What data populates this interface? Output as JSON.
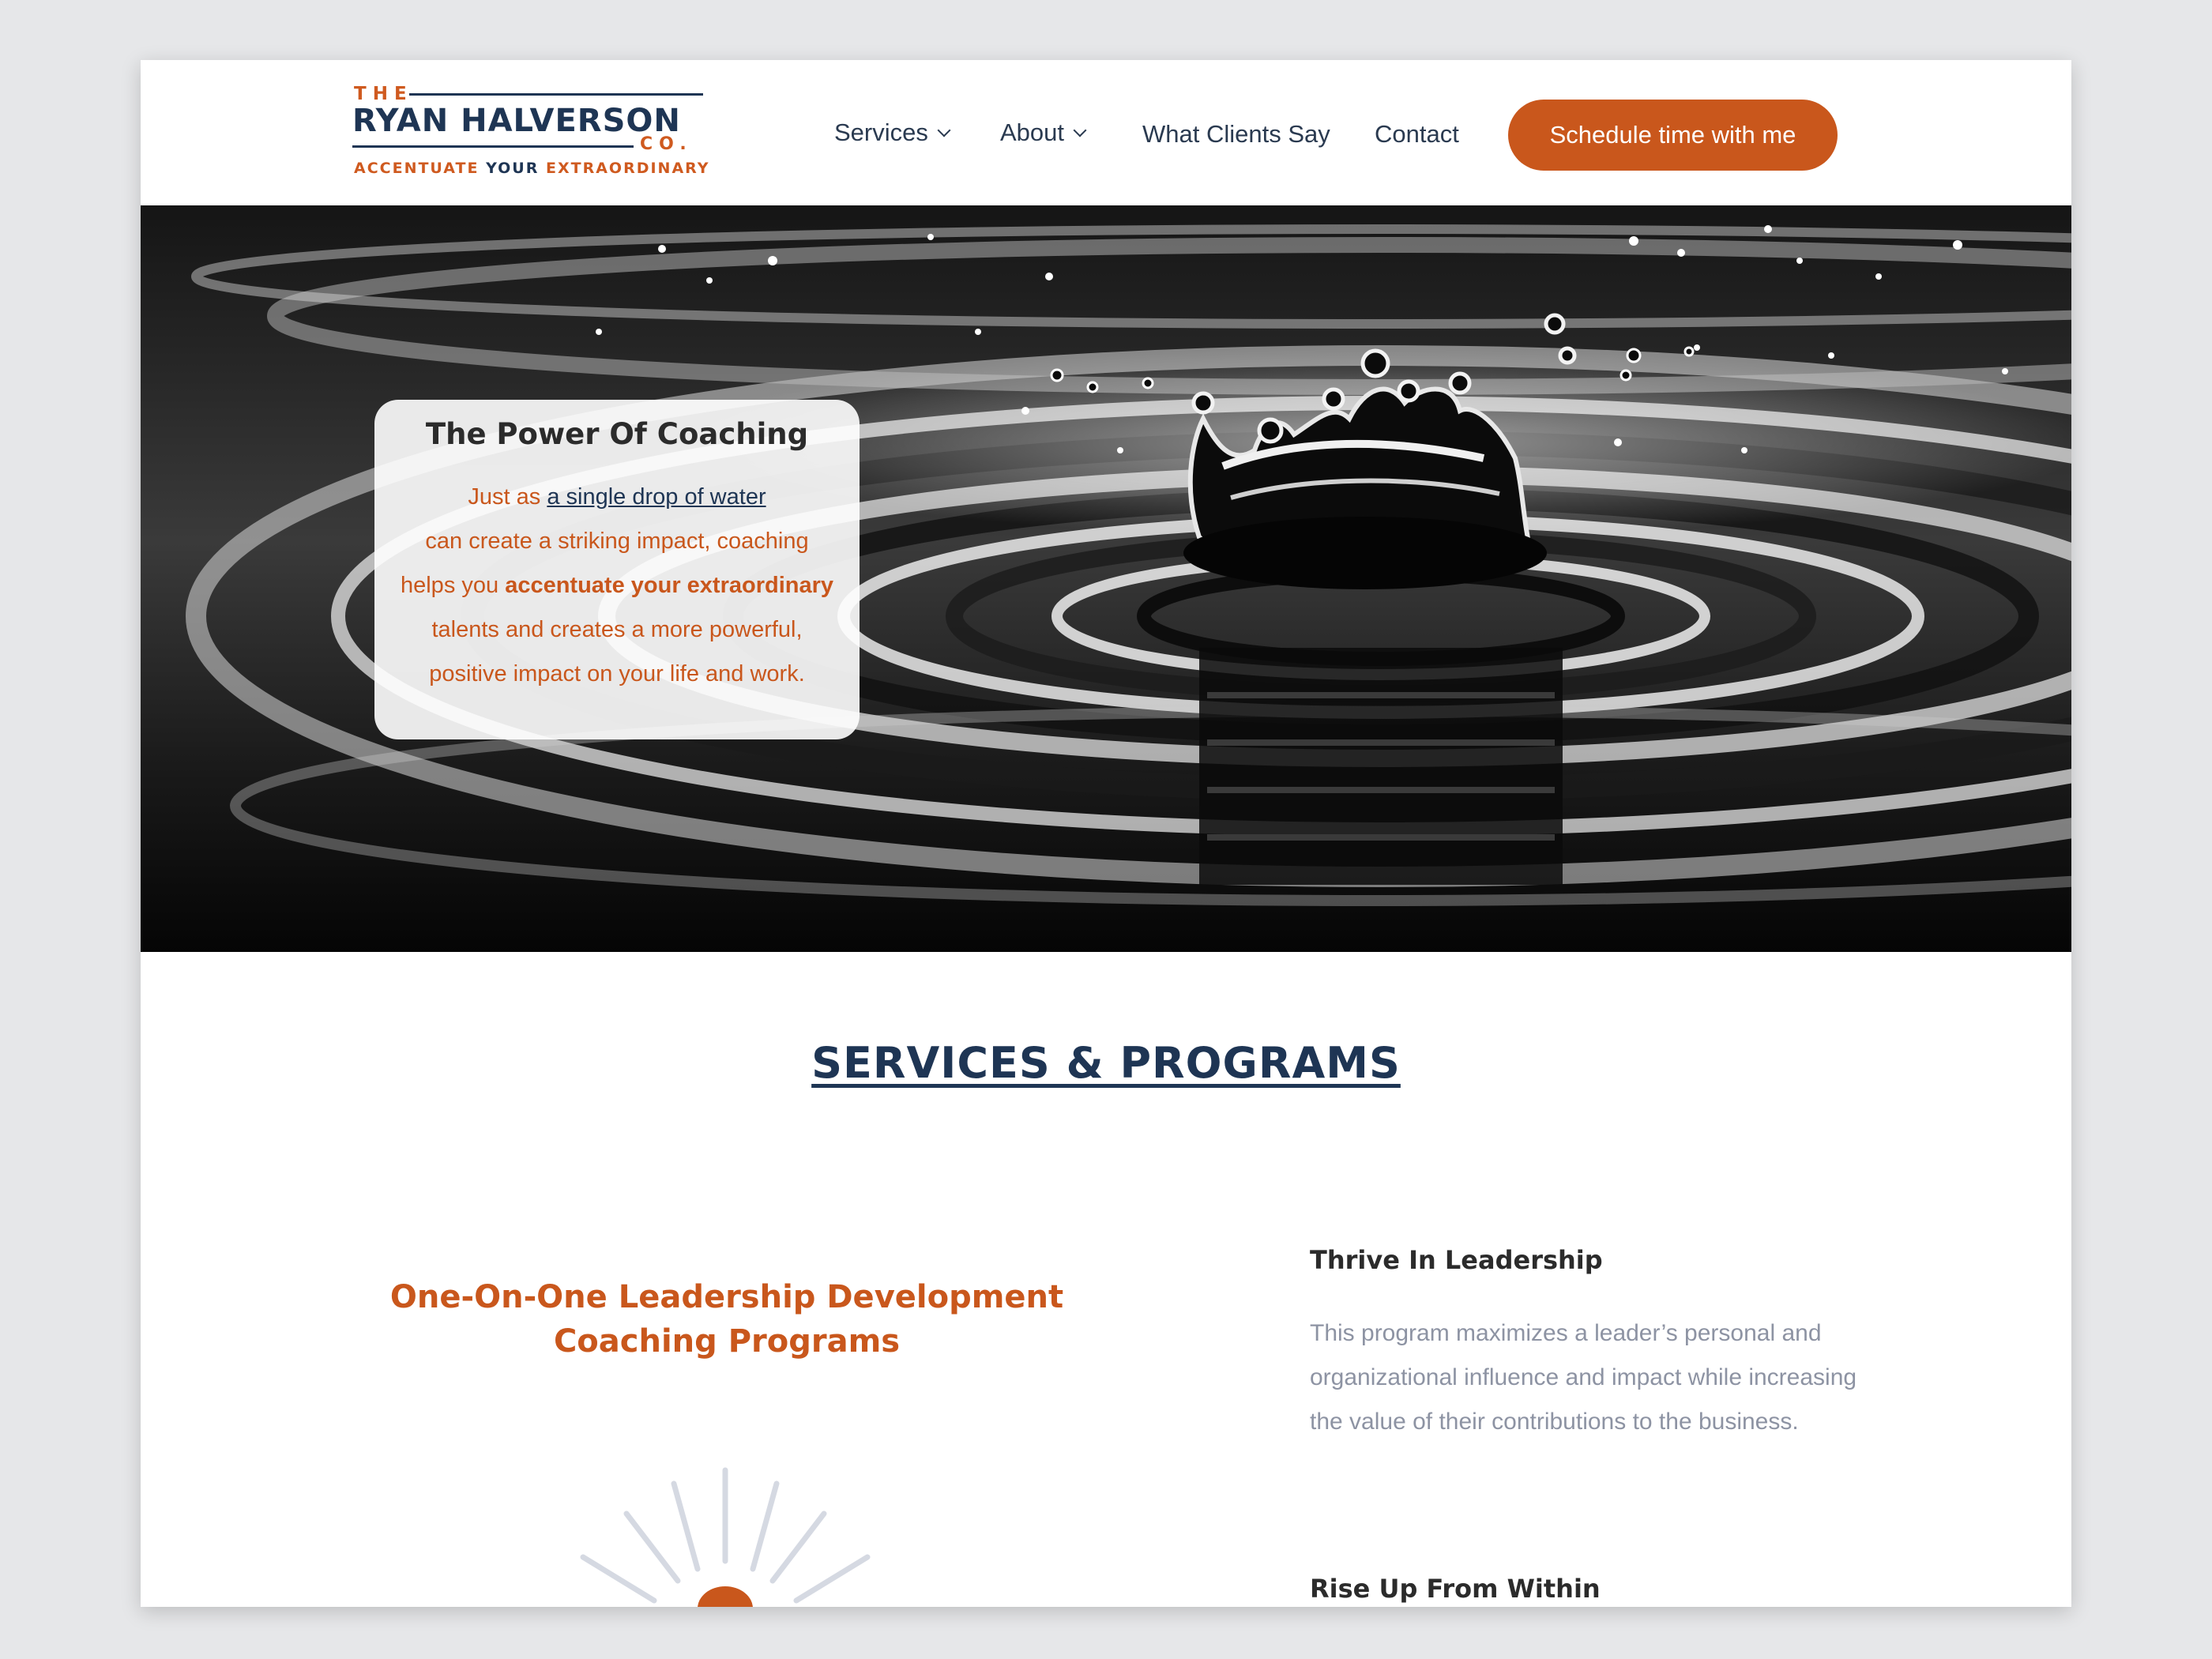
{
  "brand": {
    "the": "THE",
    "name": "RYAN HALVERSON",
    "co": "CO.",
    "tagline_a": "ACCENTUATE",
    "tagline_b": "YOUR",
    "tagline_c": "EXTRAORDINARY"
  },
  "nav": {
    "items": [
      {
        "label": "Services",
        "dropdown": true
      },
      {
        "label": "About",
        "dropdown": true
      },
      {
        "label": "What Clients Say",
        "dropdown": false
      },
      {
        "label": "Contact",
        "dropdown": false
      }
    ],
    "cta": "Schedule time with me"
  },
  "hero": {
    "title": "The Power Of Coaching",
    "line1_pre": "Just as ",
    "line1_link": "a single drop of water",
    "line2": "can create a striking impact, coaching",
    "line3_pre": "helps you ",
    "line3_bold": "accentuate your extraordinary",
    "line4": "talents and creates a more powerful,",
    "line5": "positive impact on your life and work."
  },
  "services": {
    "section_title": "SERVICES & PROGRAMS",
    "program_heading_1": "One-On-One Leadership Development",
    "program_heading_2": "Coaching Programs",
    "items": [
      {
        "title": "Thrive In Leadership",
        "description": "This program maximizes a leader’s personal and organizational influence and impact while increasing the value of their contributions to the business."
      },
      {
        "title": "Rise Up From Within",
        "description": ""
      }
    ]
  },
  "colors": {
    "brand_navy": "#1e3554",
    "brand_orange": "#c9571c",
    "muted_text": "#8d93a3",
    "page_background": "#e6e7e9"
  }
}
